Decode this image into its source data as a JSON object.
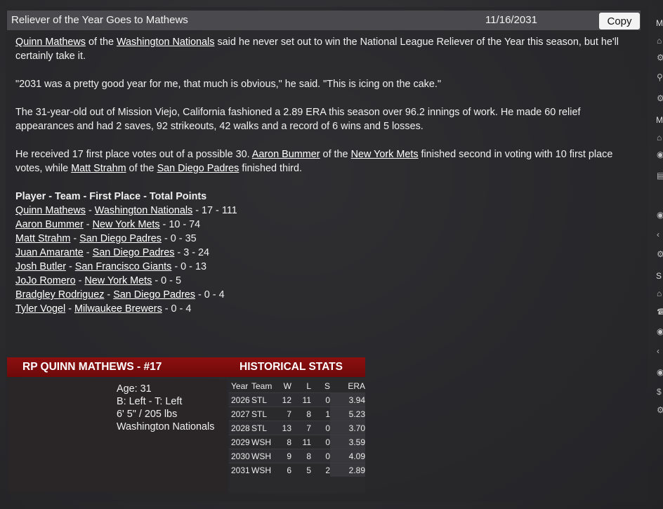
{
  "header": {
    "title": "Reliever of the Year Goes to Mathews",
    "date": "11/16/2031",
    "copy_label": "Copy"
  },
  "article": {
    "p1": {
      "player": "Quinn Mathews",
      "t1": " of the ",
      "team": "Washington Nationals",
      "t2": " said he never set out to win the National League Reliever of the Year this season, but he'll certainly take it."
    },
    "p2": "\"2031 was a pretty good year for me, that much is obvious,\" he said. \"This is icing on the cake.\"",
    "p3": "The 31-year-old out of Mission Viejo, California fashioned a 2.89 ERA this season over 96.2 innings of work. He made 60 relief appearances and had 2 saves, 92 strikeouts, 42 walks and a record of 6 wins and 5 losses.",
    "p4": {
      "t1": "He received 17 first place votes out of a possible 30. ",
      "player2": "Aaron Bummer",
      "t2": " of the ",
      "team2": "New York Mets",
      "t3": " finished second in voting with 10 first place votes, while ",
      "player3": "Matt Strahm",
      "t4": " of the ",
      "team3": "San Diego Padres",
      "t5": " finished third."
    },
    "votes_header": "Player - Team - First Place - Total Points",
    "votes": [
      {
        "player": "Quinn Mathews",
        "team": "Washington Nationals",
        "result": " - 17 - 111"
      },
      {
        "player": "Aaron Bummer",
        "team": "New York Mets",
        "result": " - 10 - 74"
      },
      {
        "player": "Matt Strahm",
        "team": "San Diego Padres",
        "result": " - 0 - 35"
      },
      {
        "player": "Juan Amarante",
        "team": "San Diego Padres",
        "result": " - 3 - 24"
      },
      {
        "player": "Josh Butler",
        "team": "San Francisco Giants",
        "result": " - 0 - 13"
      },
      {
        "player": "JoJo Romero",
        "team": "New York Mets",
        "result": " - 0 - 5"
      },
      {
        "player": "Bradgley Rodriguez",
        "team": "San Diego Padres",
        "result": " - 0 - 4"
      },
      {
        "player": "Tyler Vogel",
        "team": "Milwaukee Brewers",
        "result": " - 0 - 4"
      }
    ]
  },
  "card": {
    "title": "RP QUINN MATHEWS - #17",
    "stats_title": "HISTORICAL STATS",
    "age": "Age: 31",
    "bats_throws": "B: Left - T: Left",
    "height_weight": "6' 5\"  / 205 lbs",
    "team": "Washington Nationals"
  },
  "stats": {
    "headers": [
      "Year",
      "Team",
      "W",
      "L",
      "S",
      "ERA"
    ],
    "rows": [
      [
        "2026",
        "STL",
        "12",
        "11",
        "0",
        "3.94"
      ],
      [
        "2027",
        "STL",
        "7",
        "8",
        "1",
        "5.23"
      ],
      [
        "2028",
        "STL",
        "13",
        "7",
        "0",
        "3.70"
      ],
      [
        "2029",
        "WSH",
        "8",
        "11",
        "0",
        "3.59"
      ],
      [
        "2030",
        "WSH",
        "9",
        "8",
        "0",
        "4.09"
      ],
      [
        "2031",
        "WSH",
        "6",
        "5",
        "2",
        "2.89"
      ]
    ]
  },
  "rail": {
    "letters": [
      "M",
      "M",
      "S"
    ],
    "icons": [
      "home-icon",
      "gear-icon",
      "search-icon",
      "share-icon",
      "settings-icon"
    ]
  }
}
